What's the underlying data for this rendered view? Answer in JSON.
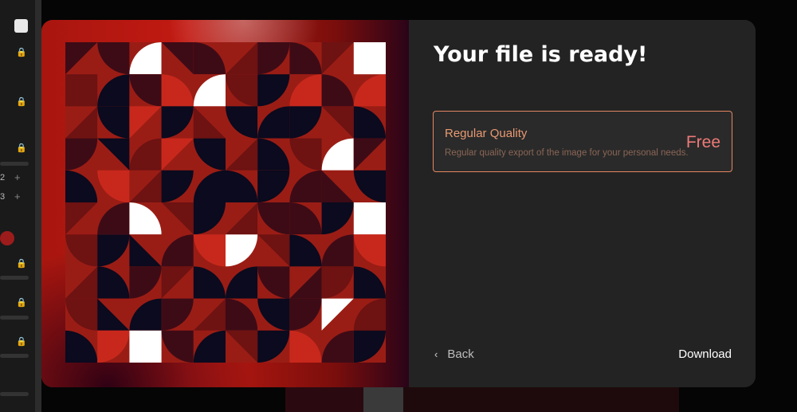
{
  "background": {
    "numbers": [
      "2",
      "3"
    ],
    "plus_glyph": "+",
    "lock_glyph": "🔒"
  },
  "dialog": {
    "title": "Your file is ready!",
    "options": [
      {
        "name": "Regular Quality",
        "description": "Regular quality export of the image for your personal needs.",
        "price": "Free"
      }
    ],
    "back_label": "Back",
    "back_icon": "chevron-left-icon",
    "download_label": "Download"
  },
  "colors": {
    "accent": "#e48660",
    "price": "#ee7a78",
    "pattern_red": "#9a1d15",
    "pattern_dark_red": "#6e1212",
    "pattern_navy": "#0b0a1e",
    "pattern_maroon": "#3d0b16",
    "pattern_bright": "#c8281c",
    "pattern_white": "#ffffff"
  }
}
